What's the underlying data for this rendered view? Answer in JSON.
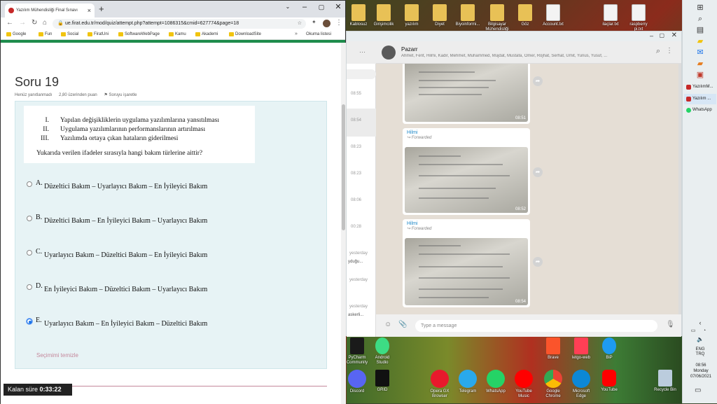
{
  "browser": {
    "tab_title": "Yazılım Mühendisliği Final Sınavı",
    "url": "ue.firat.edu.tr/mod/quiz/attempt.php?attempt=1086315&cmid=627774&page=18",
    "bookmarks": [
      "Google",
      "Fun",
      "Social",
      "FiratUni",
      "SoftwareWebPage",
      "Kamu",
      "Akademi",
      "DownloadSite"
    ],
    "reading_list": "Okuma listesi"
  },
  "quiz": {
    "title": "Soru 19",
    "status": "Henüz yanıtlanmadı",
    "points": "2,80 üzerinden puan",
    "flag": "Soruyu işaretle",
    "statements": [
      {
        "n": "I.",
        "t": "Yapılan değişikliklerin uygulama yazılımlarına yansıtılması"
      },
      {
        "n": "II.",
        "t": "Uygulama yazılımlarının performanslarının artırılması"
      },
      {
        "n": "III.",
        "t": "Yazılımda ortaya çıkan hataların giderilmesi"
      }
    ],
    "question": "Yukarıda verilen ifadeler sırasıyla hangi bakım türlerine aittir?",
    "options": [
      {
        "letter": "A.",
        "text": "Düzeltici Bakım – Uyarlayıcı Bakım – En İyileyici Bakım",
        "selected": false
      },
      {
        "letter": "B.",
        "text": "Düzeltici Bakım – En İyileyici Bakım – Uyarlayıcı Bakım",
        "selected": false
      },
      {
        "letter": "C.",
        "text": "Uyarlayıcı Bakım – Düzeltici Bakım – En İyileyici Bakım",
        "selected": false
      },
      {
        "letter": "D.",
        "text": "En İyileyici Bakım – Düzeltici Bakım – Uyarlayıcı Bakım",
        "selected": false
      },
      {
        "letter": "E.",
        "text": "Uyarlayıcı Bakım – En İyileyici Bakım – Düzeltici Bakım",
        "selected": true
      }
    ],
    "clear_choice": "Seçimimi temizle",
    "timer_label": "Kalan süre",
    "timer_value": "0:33:22"
  },
  "whatsapp": {
    "chat_name": "Pazarr",
    "members": "Ahmet, Ferit, Hilmi, Kadir, Mehmet, Muhammed, Mujdat, Mustafa, Ömer, Rojhat, Serhat, Ümit, Yunus, Yusuf, ...",
    "list_times": [
      "08:55",
      "08:54",
      "08:23",
      "08:23",
      "08:06",
      "00:28",
      "yesterday",
      "yesterday",
      "yesterday"
    ],
    "list_snippets": [
      "yduğu...",
      "askerli..."
    ],
    "messages": [
      {
        "sender": "",
        "forwarded": "",
        "time": "08:51"
      },
      {
        "sender": "Hilmi",
        "forwarded": "Forwarded",
        "time": "08:52"
      },
      {
        "sender": "Hilmi",
        "forwarded": "Forwarded",
        "time": "08:54"
      }
    ],
    "input_placeholder": "Type a message"
  },
  "desktop": {
    "top_icons": [
      "Kablosuz",
      "Girişimcilik",
      "yazılım",
      "Diyet",
      "Biyoinformi...",
      "Bilgisayar Mühendisliği",
      "Göz",
      "Account.txt",
      "ilaçlar.txt",
      "raspberry pi.txt"
    ],
    "bottom_icons": [
      "PyCharm Community",
      "Android Studio",
      "Brave",
      "letgo-web",
      "BiP",
      "Discord",
      "GRID",
      "Opera GX Browser",
      "Telegram",
      "WhatsApp",
      "YouTube Music",
      "Google Chrome",
      "Microsoft Edge",
      "YouTube",
      "Recycle Bin"
    ]
  },
  "taskbar": {
    "apps": [
      "YazılımM...",
      "Yazılım ...",
      "WhatsApp"
    ],
    "lang": "ENG",
    "region": "TRQ",
    "time": "08:56",
    "day": "Monday",
    "date": "07/06/2021"
  }
}
